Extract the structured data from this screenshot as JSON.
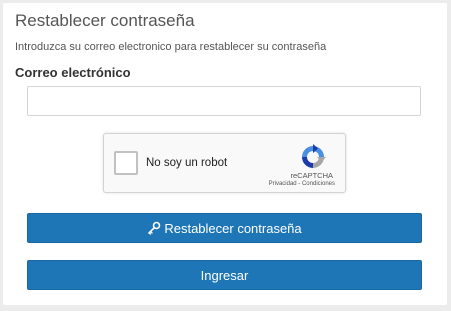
{
  "form": {
    "title": "Restablecer contraseña",
    "subtitle": "Introduzca su correo electronico para restablecer su contraseña",
    "email_label": "Correo electrónico",
    "email_value": ""
  },
  "recaptcha": {
    "label": "No soy un robot",
    "brand": "reCAPTCHA",
    "links": "Privacidad - Condiciones",
    "checked": false
  },
  "buttons": {
    "reset_label": "Restablecer contraseña",
    "reset_icon": "key-icon",
    "login_label": "Ingresar"
  },
  "colors": {
    "primary": "#1e76b7",
    "background": "#ececec"
  }
}
